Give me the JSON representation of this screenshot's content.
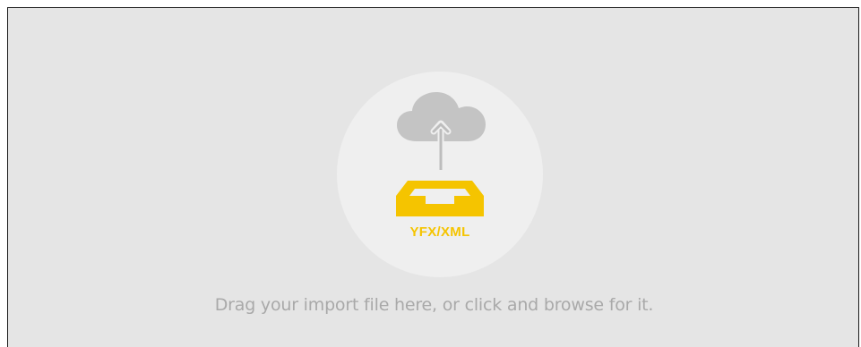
{
  "dropzone": {
    "format_label": "YFX/XML",
    "instruction": "Drag your import file here, or click and browse for it.",
    "icons": {
      "upload": "cloud-upload-icon",
      "tray": "inbox-tray-icon"
    },
    "colors": {
      "background": "#e5e5e5",
      "circle": "#efefef",
      "accent": "#f5c400",
      "cloud": "#c4c4c4",
      "text": "#a9a9a9"
    }
  }
}
